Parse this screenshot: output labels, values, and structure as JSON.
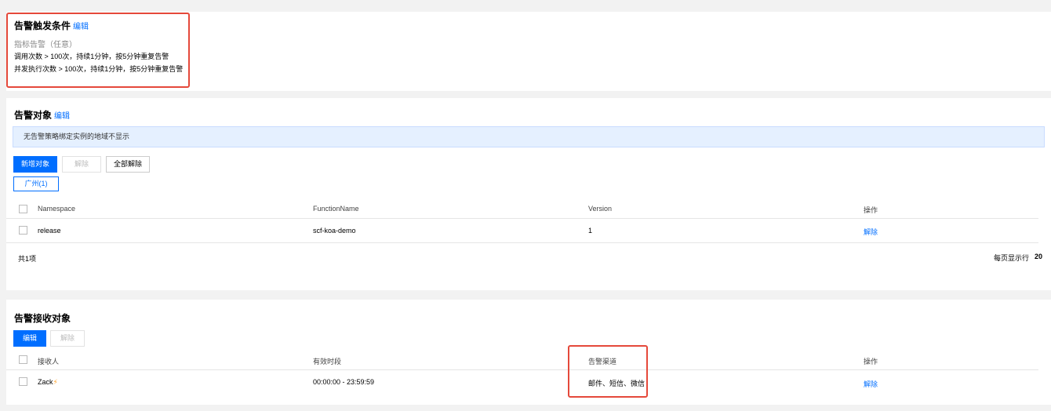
{
  "trigger": {
    "title": "告警触发条件",
    "edit": "编辑",
    "subtitle": "指标告警（任意）",
    "conditions": [
      "调用次数 > 100次，持续1分钟，按5分钟重复告警",
      "并发执行次数 > 100次，持续1分钟，按5分钟重复告警"
    ]
  },
  "objects": {
    "title": "告警对象",
    "edit": "编辑",
    "notice": "无告警策略绑定实例的地域不显示",
    "buttons": {
      "add": "新增对象",
      "unbind": "解除",
      "unbind_all": "全部解除"
    },
    "region_tab": "广州(1)",
    "columns": [
      "Namespace",
      "FunctionName",
      "Version",
      "操作"
    ],
    "rows": [
      {
        "namespace": "release",
        "function": "scf-koa-demo",
        "version": "1",
        "action": "解除"
      }
    ],
    "total": "共1项",
    "per_page_label": "每页显示行",
    "per_page_value": "20"
  },
  "receivers": {
    "title": "告警接收对象",
    "buttons": {
      "edit": "编辑",
      "unbind": "解除"
    },
    "columns": [
      "接收人",
      "有效时段",
      "告警渠道",
      "操作"
    ],
    "rows": [
      {
        "name": "Zack",
        "period": "00:00:00 - 23:59:59",
        "channels": "邮件、短信、微信",
        "action": "解除"
      }
    ]
  },
  "colors": {
    "accent": "#006eff",
    "highlight": "#e5493b",
    "notice_bg": "#e5f0ff"
  },
  "icons": {
    "receiver_badge": "lightning-icon"
  }
}
